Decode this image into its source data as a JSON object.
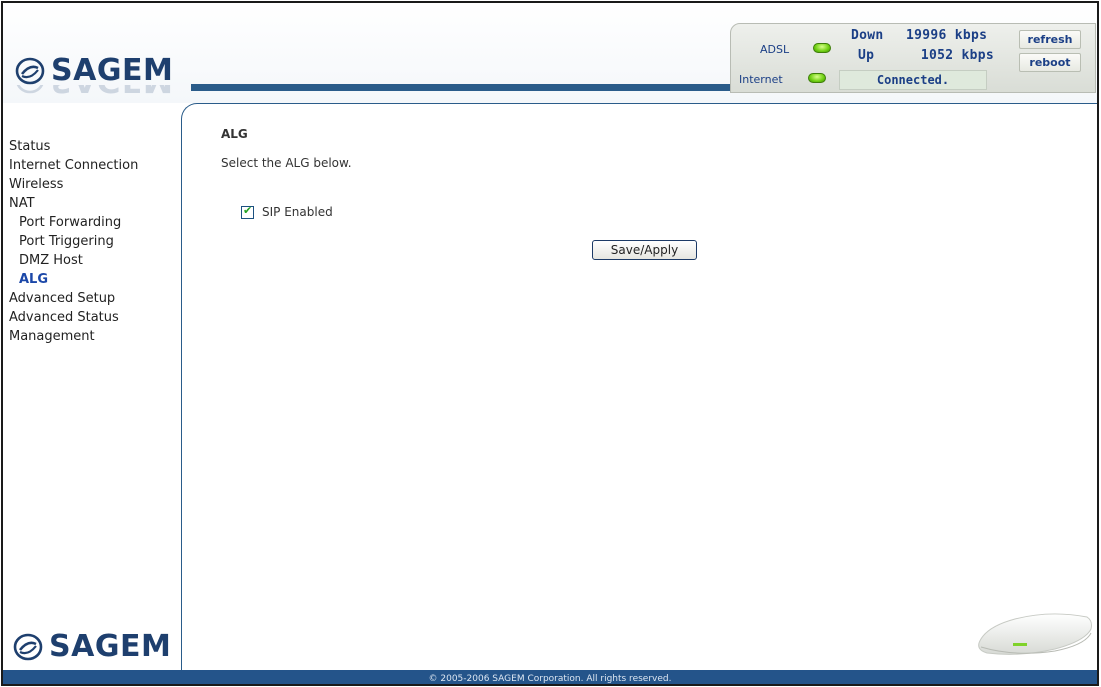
{
  "brand": {
    "name": "SAGEM"
  },
  "status": {
    "adsl_label": "ADSL",
    "internet_label": "Internet",
    "down_label": "Down",
    "down_value": "19996 kbps",
    "up_label": "Up",
    "up_value": "1052 kbps",
    "connection_state": "Connected.",
    "refresh_label": "refresh",
    "reboot_label": "reboot",
    "led_color": "#6fcf12"
  },
  "sidebar": {
    "items": [
      {
        "label": "Status"
      },
      {
        "label": "Internet Connection"
      },
      {
        "label": "Wireless"
      },
      {
        "label": "NAT"
      },
      {
        "label": "Port Forwarding"
      },
      {
        "label": "Port Triggering"
      },
      {
        "label": "DMZ Host"
      },
      {
        "label": "ALG"
      },
      {
        "label": "Advanced Setup"
      },
      {
        "label": "Advanced Status"
      },
      {
        "label": "Management"
      }
    ]
  },
  "main": {
    "title": "ALG",
    "description": "Select the ALG below.",
    "sip_label": "SIP Enabled",
    "sip_checked": true,
    "save_label": "Save/Apply"
  },
  "footer": {
    "copyright": "© 2005-2006 SAGEM Corporation. All rights reserved."
  },
  "colors": {
    "accent": "#2a5c8a",
    "brand": "#1e3f6e",
    "active_nav": "#1b47a8"
  }
}
